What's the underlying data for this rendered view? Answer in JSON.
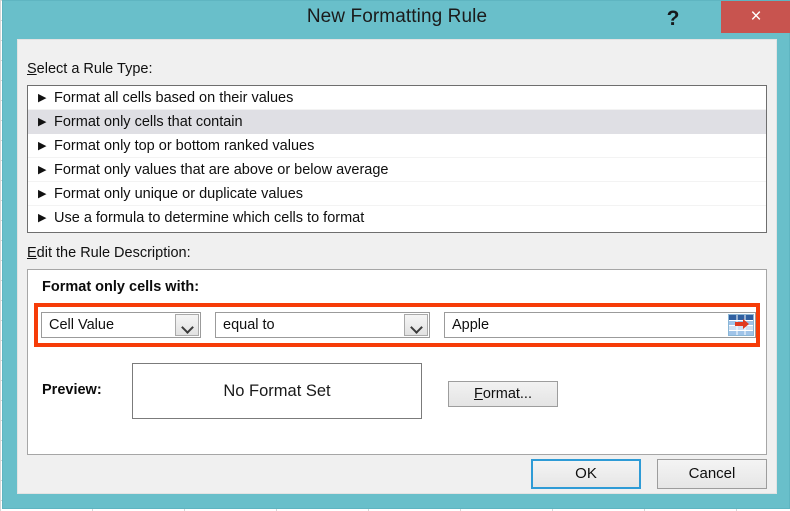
{
  "window": {
    "title": "New Formatting Rule",
    "help_icon": "?",
    "close_icon": "×",
    "titlebar_color": "#69bfca",
    "close_button_color": "#c8544f"
  },
  "annotation": {
    "color": "#f63c08",
    "shape": "rectangle"
  },
  "rule_type": {
    "label_accel": "S",
    "label_rest": "elect a Rule Type:",
    "bullet": "▶",
    "items": [
      {
        "label": "Format all cells based on their values",
        "selected": false
      },
      {
        "label": "Format only cells that contain",
        "selected": true
      },
      {
        "label": "Format only top or bottom ranked values",
        "selected": false
      },
      {
        "label": "Format only values that are above or below average",
        "selected": false
      },
      {
        "label": "Format only unique or duplicate values",
        "selected": false
      },
      {
        "label": "Use a formula to determine which cells to format",
        "selected": false
      }
    ]
  },
  "edit_description": {
    "label_accel": "E",
    "label_rest": "dit the Rule Description:",
    "group_heading": "Format only cells with:",
    "rule_subtype": {
      "value": "Cell Value",
      "icon": "chevron-down-icon"
    },
    "operator": {
      "value": "equal to",
      "icon": "chevron-down-icon"
    },
    "value_field": {
      "value": "Apple",
      "placeholder": "",
      "picker_icon": "range-picker-icon"
    },
    "preview": {
      "label": "Preview:",
      "text": "No Format Set"
    },
    "format_button": {
      "accel": "F",
      "rest": "ormat..."
    }
  },
  "footer": {
    "ok_label": "OK",
    "cancel_label": "Cancel"
  }
}
